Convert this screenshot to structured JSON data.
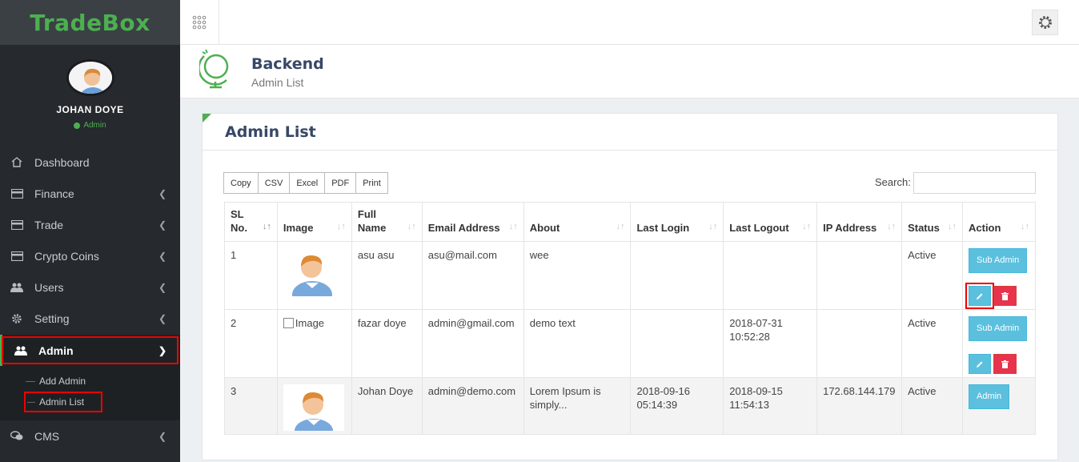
{
  "brand": {
    "name": "TradeBox"
  },
  "profile": {
    "name": "JOHAN DOYE",
    "role": "Admin"
  },
  "sidebar": {
    "items": [
      {
        "label": "Dashboard",
        "icon": "home-icon",
        "has_submenu": false
      },
      {
        "label": "Finance",
        "icon": "card-icon",
        "has_submenu": true
      },
      {
        "label": "Trade",
        "icon": "card-icon",
        "has_submenu": true
      },
      {
        "label": "Crypto Coins",
        "icon": "card-icon",
        "has_submenu": true
      },
      {
        "label": "Users",
        "icon": "users-icon",
        "has_submenu": true
      },
      {
        "label": "Setting",
        "icon": "gear-icon",
        "has_submenu": true
      },
      {
        "label": "Admin",
        "icon": "users-icon",
        "has_submenu": true,
        "expanded": true
      },
      {
        "label": "CMS",
        "icon": "chat-icon",
        "has_submenu": true
      }
    ],
    "admin_sub": [
      "Add Admin",
      "Admin List"
    ]
  },
  "header": {
    "title": "Backend",
    "subtitle": "Admin List"
  },
  "panel": {
    "title": "Admin List",
    "export_buttons": [
      "Copy",
      "CSV",
      "Excel",
      "PDF",
      "Print"
    ],
    "search_label": "Search:",
    "columns": [
      "SL No.",
      "Image",
      "Full Name",
      "Email Address",
      "About",
      "Last Login",
      "Last Logout",
      "IP Address",
      "Status",
      "Action"
    ],
    "rows": [
      {
        "sl": "1",
        "image": "avatar",
        "name": "asu asu",
        "email": "asu@mail.com",
        "about": "wee",
        "last_login": "",
        "last_logout": "",
        "ip": "",
        "status": "Active",
        "role_button": "Sub Admin"
      },
      {
        "sl": "2",
        "image": "Image",
        "name": "fazar doye",
        "email": "admin@gmail.com",
        "about": "demo text",
        "last_login": "",
        "last_logout": "2018-07-31 10:52:28",
        "ip": "",
        "status": "Active",
        "role_button": "Sub Admin"
      },
      {
        "sl": "3",
        "image": "avatar",
        "name": "Johan Doye",
        "email": "admin@demo.com",
        "about": "Lorem Ipsum is simply...",
        "last_login": "2018-09-16 05:14:39",
        "last_logout": "2018-09-15 11:54:13",
        "ip": "172.68.144.179",
        "status": "Active",
        "role_button": "Admin"
      }
    ]
  },
  "colors": {
    "accent": "#4cb050",
    "sidebar": "#26292d",
    "info": "#5bc0de",
    "danger": "#e7344c",
    "highlight": "#e00000"
  }
}
